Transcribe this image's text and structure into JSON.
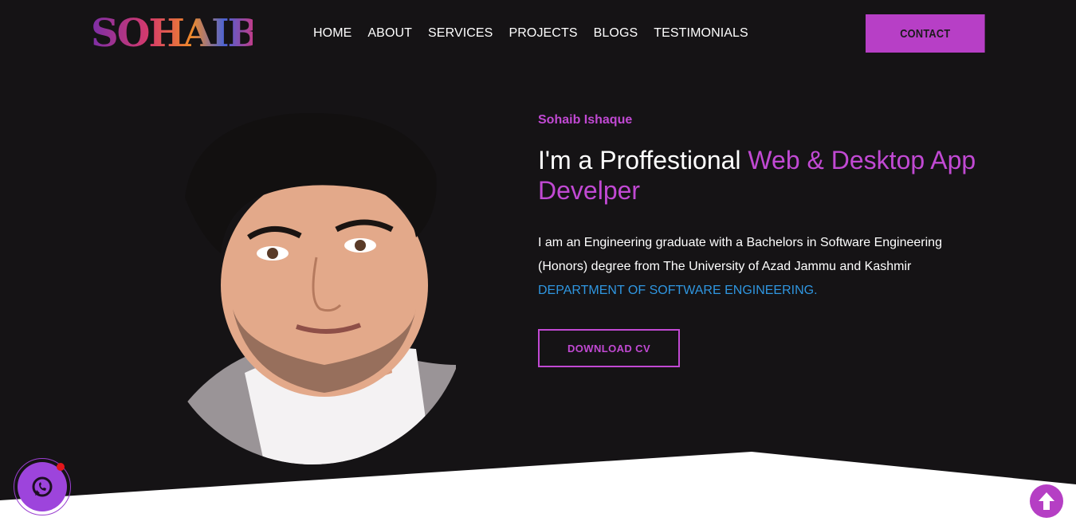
{
  "brand": {
    "logo_text": "SOHAIB"
  },
  "nav": {
    "items": [
      {
        "label": "HOME"
      },
      {
        "label": "ABOUT"
      },
      {
        "label": "SERVICES"
      },
      {
        "label": "PROJECTS"
      },
      {
        "label": "BLOGS"
      },
      {
        "label": "TESTIMONIALS"
      }
    ],
    "contact_label": "CONTACT"
  },
  "hero": {
    "name": "Sohaib Ishaque",
    "title_plain": "I'm a Proffestional ",
    "title_highlight": "Web & Desktop App Develper",
    "description": "I am an Engineering graduate with a Bachelors in Software Engineering (Honors) degree from The University of Azad Jammu and Kashmir ",
    "department": "DEPARTMENT OF SOFTWARE ENGINEERING.",
    "cv_button": "DOWNLOAD CV"
  },
  "widgets": {
    "whatsapp_icon": "whatsapp-icon",
    "scroll_top_icon": "arrow-up-icon"
  },
  "colors": {
    "accent": "#c149d3",
    "background": "#151315",
    "link": "#2f96e0"
  }
}
